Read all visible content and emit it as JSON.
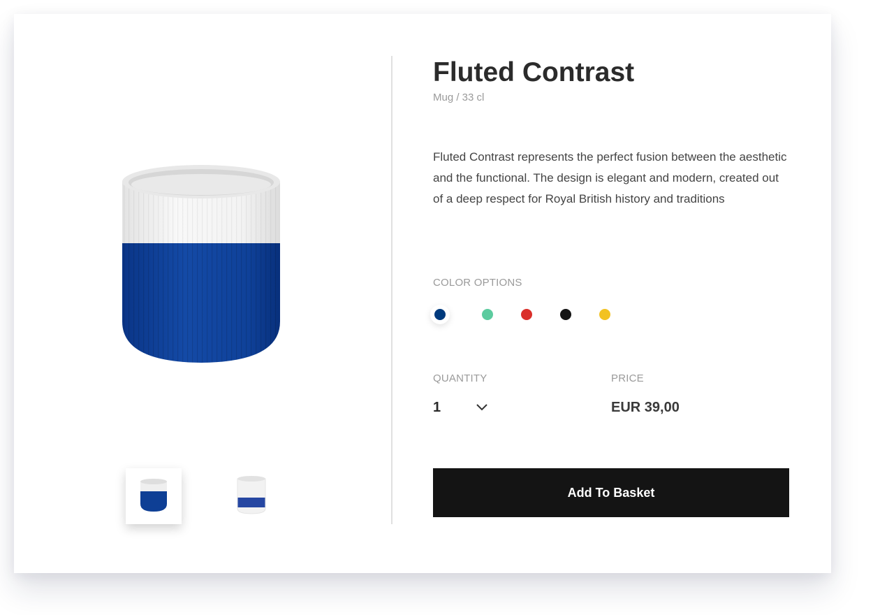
{
  "product": {
    "name": "Fluted Contrast",
    "subtitle": "Mug / 33 cl",
    "description": "Fluted Contrast represents the perfect fusion between the aesthetic and the functional. The design is elegant and modern, created out of a deep respect for Royal British history and traditions"
  },
  "gallery": {
    "thumbnails": [
      {
        "icon": "mug-blue-icon",
        "active": true
      },
      {
        "icon": "mug-white-icon",
        "active": false
      }
    ]
  },
  "colors": {
    "label": "COLOR OPTIONS",
    "options": [
      {
        "hex": "#003a7d",
        "selected": true
      },
      {
        "hex": "#5ccb9f",
        "selected": false
      },
      {
        "hex": "#da2f2a",
        "selected": false
      },
      {
        "hex": "#141414",
        "selected": false
      },
      {
        "hex": "#f2c221",
        "selected": false
      }
    ]
  },
  "quantity": {
    "label": "QUANTITY",
    "value": "1",
    "icon": "chevron-down-icon"
  },
  "price": {
    "label": "PRICE",
    "value": "EUR 39,00"
  },
  "actions": {
    "add_to_basket": "Add To Basket"
  },
  "theme": {
    "mug_blue": "#0e3f95",
    "mug_white": "#f1f1f1",
    "button_bg": "#141414"
  }
}
